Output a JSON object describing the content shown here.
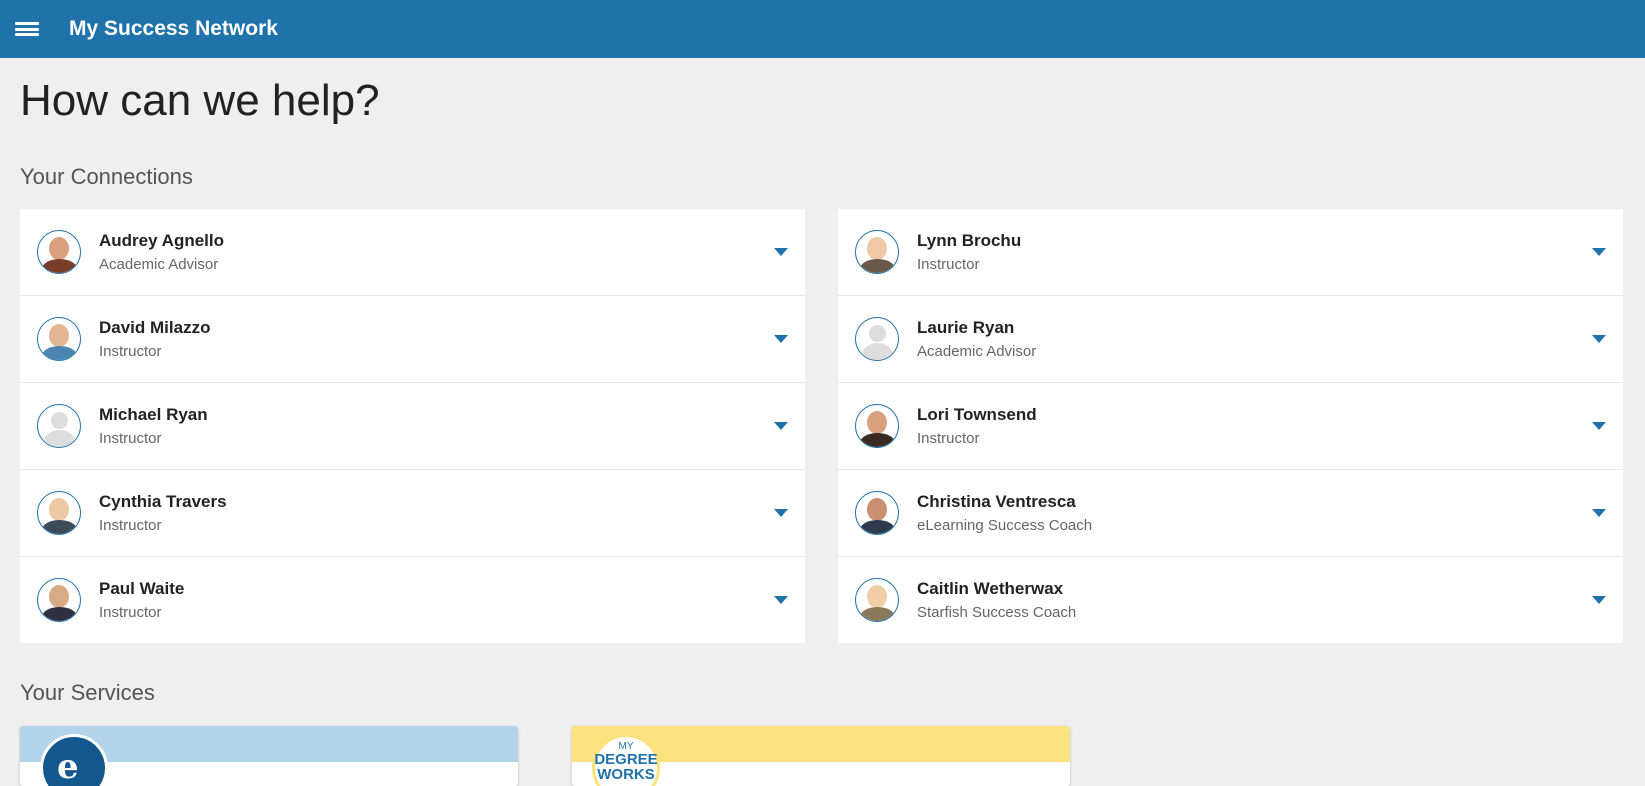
{
  "header": {
    "title": "My Success Network",
    "menu_icon": "hamburger-menu-icon",
    "background_color": "#1f72aa"
  },
  "page": {
    "title": "How can we help?"
  },
  "connections": {
    "heading": "Your Connections",
    "left": [
      {
        "name": "Audrey Agnello",
        "role": "Academic Advisor"
      },
      {
        "name": "David Milazzo",
        "role": "Instructor"
      },
      {
        "name": "Michael Ryan",
        "role": "Instructor"
      },
      {
        "name": "Cynthia Travers",
        "role": "Instructor"
      },
      {
        "name": "Paul Waite",
        "role": "Instructor"
      }
    ],
    "right": [
      {
        "name": "Lynn Brochu",
        "role": "Instructor"
      },
      {
        "name": "Laurie Ryan",
        "role": "Academic Advisor"
      },
      {
        "name": "Lori Townsend",
        "role": "Instructor"
      },
      {
        "name": "Christina Ventresca",
        "role": "eLearning Success Coach"
      },
      {
        "name": "Caitlin Wetherwax",
        "role": "Starfish Success Coach"
      }
    ]
  },
  "services": {
    "heading": "Your Services",
    "cards": [
      {
        "logo_icon": "elearning-graduation-cap-logo",
        "logo_text": "e",
        "band_color": "#b3d3ea"
      },
      {
        "logo_icon": "my-degree-works-logo",
        "logo_line1": "MY",
        "logo_line2": "DEGREE",
        "logo_line3": "WORKS",
        "band_color": "#fbe27c"
      }
    ]
  }
}
